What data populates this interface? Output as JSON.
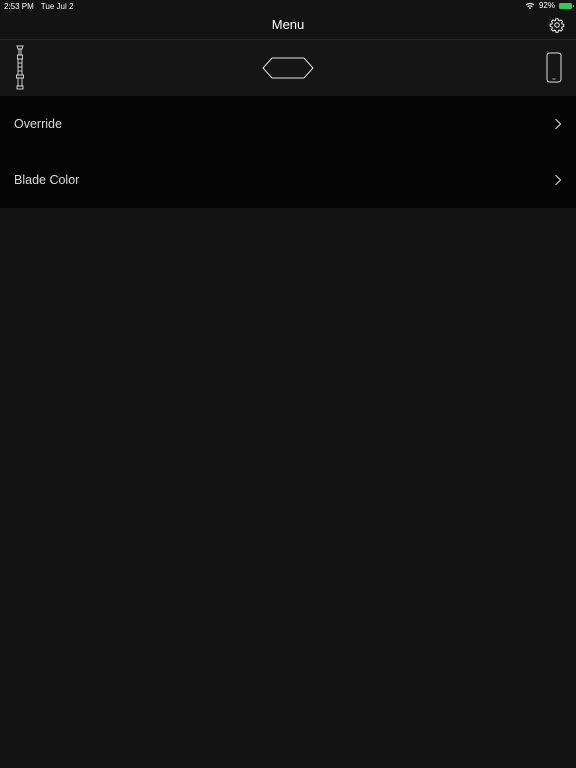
{
  "status_bar": {
    "time": "2:53 PM",
    "date": "Tue Jul 2",
    "battery_percent": "92%",
    "battery_level": 0.92,
    "wifi": "wifi-icon"
  },
  "nav": {
    "title": "Menu",
    "settings_icon": "gear-icon"
  },
  "devices": {
    "left_icon": "lightsaber-icon",
    "center_icon": "hex-emitter-icon",
    "right_icon": "phone-icon"
  },
  "menu": {
    "items": [
      {
        "label": "Override",
        "icon": "chevron-right-icon"
      },
      {
        "label": "Blade Color",
        "icon": "chevron-right-icon"
      }
    ]
  },
  "colors": {
    "background": "#131313",
    "list_background": "#050505",
    "battery": "#34c759",
    "text": "#ffffff"
  }
}
